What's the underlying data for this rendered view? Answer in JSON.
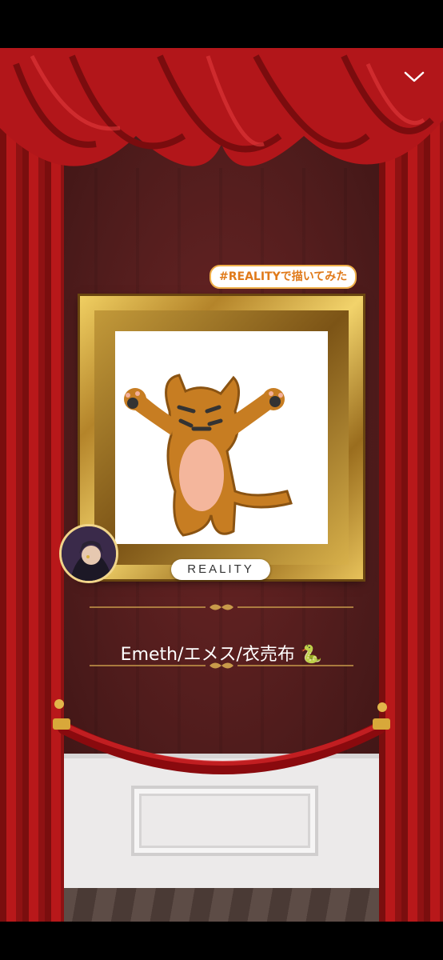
{
  "header": {
    "collapse_icon": "chevron-down-icon"
  },
  "hashtag": "#REALITYで描いてみた",
  "brand": "REALITY",
  "artist": {
    "name": "Emeth/エメス/衣売布 🐍",
    "avatar_icon": "avatar"
  },
  "colors": {
    "curtain": "#b8181a",
    "wall": "#4a1a1a",
    "frame_gold": "#d8b04a",
    "tag_orange": "#e07a1a"
  }
}
